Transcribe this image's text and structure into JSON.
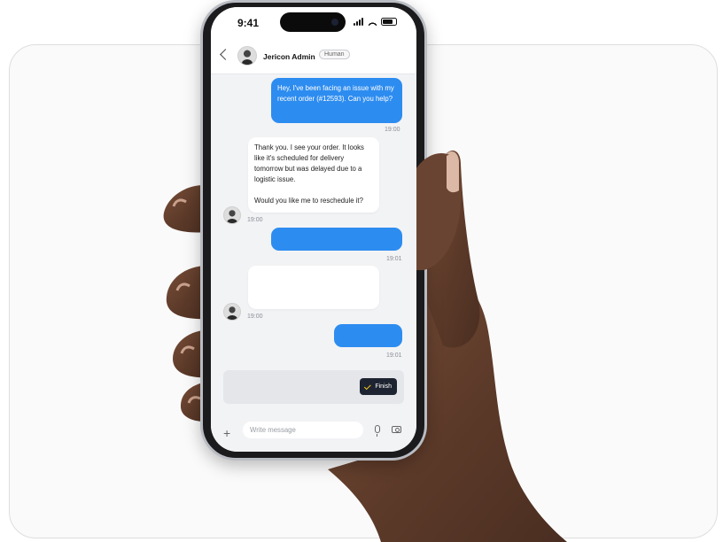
{
  "status_bar": {
    "time": "9:41"
  },
  "header": {
    "agent_name": "Jericon Admin",
    "agent_badge": "Human"
  },
  "messages": [
    {
      "direction": "outgoing",
      "text": "Hey, I've been facing an issue with my recent order (#12593). Can you help?",
      "time": "19:00"
    },
    {
      "direction": "incoming",
      "text_lines": [
        "Thank you. I see your order. It looks like it's scheduled for delivery tomorrow but was delayed due to a logistic issue.",
        "Would you like me to reschedule it?"
      ],
      "time": "19:00"
    },
    {
      "direction": "outgoing",
      "text": "",
      "time": "19:01"
    },
    {
      "direction": "incoming",
      "text": "",
      "time": "19:00"
    },
    {
      "direction": "outgoing",
      "text": "",
      "time": "19:01"
    }
  ],
  "action_bar": {
    "finish_label": "Finish"
  },
  "composer": {
    "placeholder": "Write message"
  },
  "colors": {
    "outgoing_bubble": "#2d8cf0",
    "finish_button": "#1d2330",
    "skin": "#6b4430"
  }
}
